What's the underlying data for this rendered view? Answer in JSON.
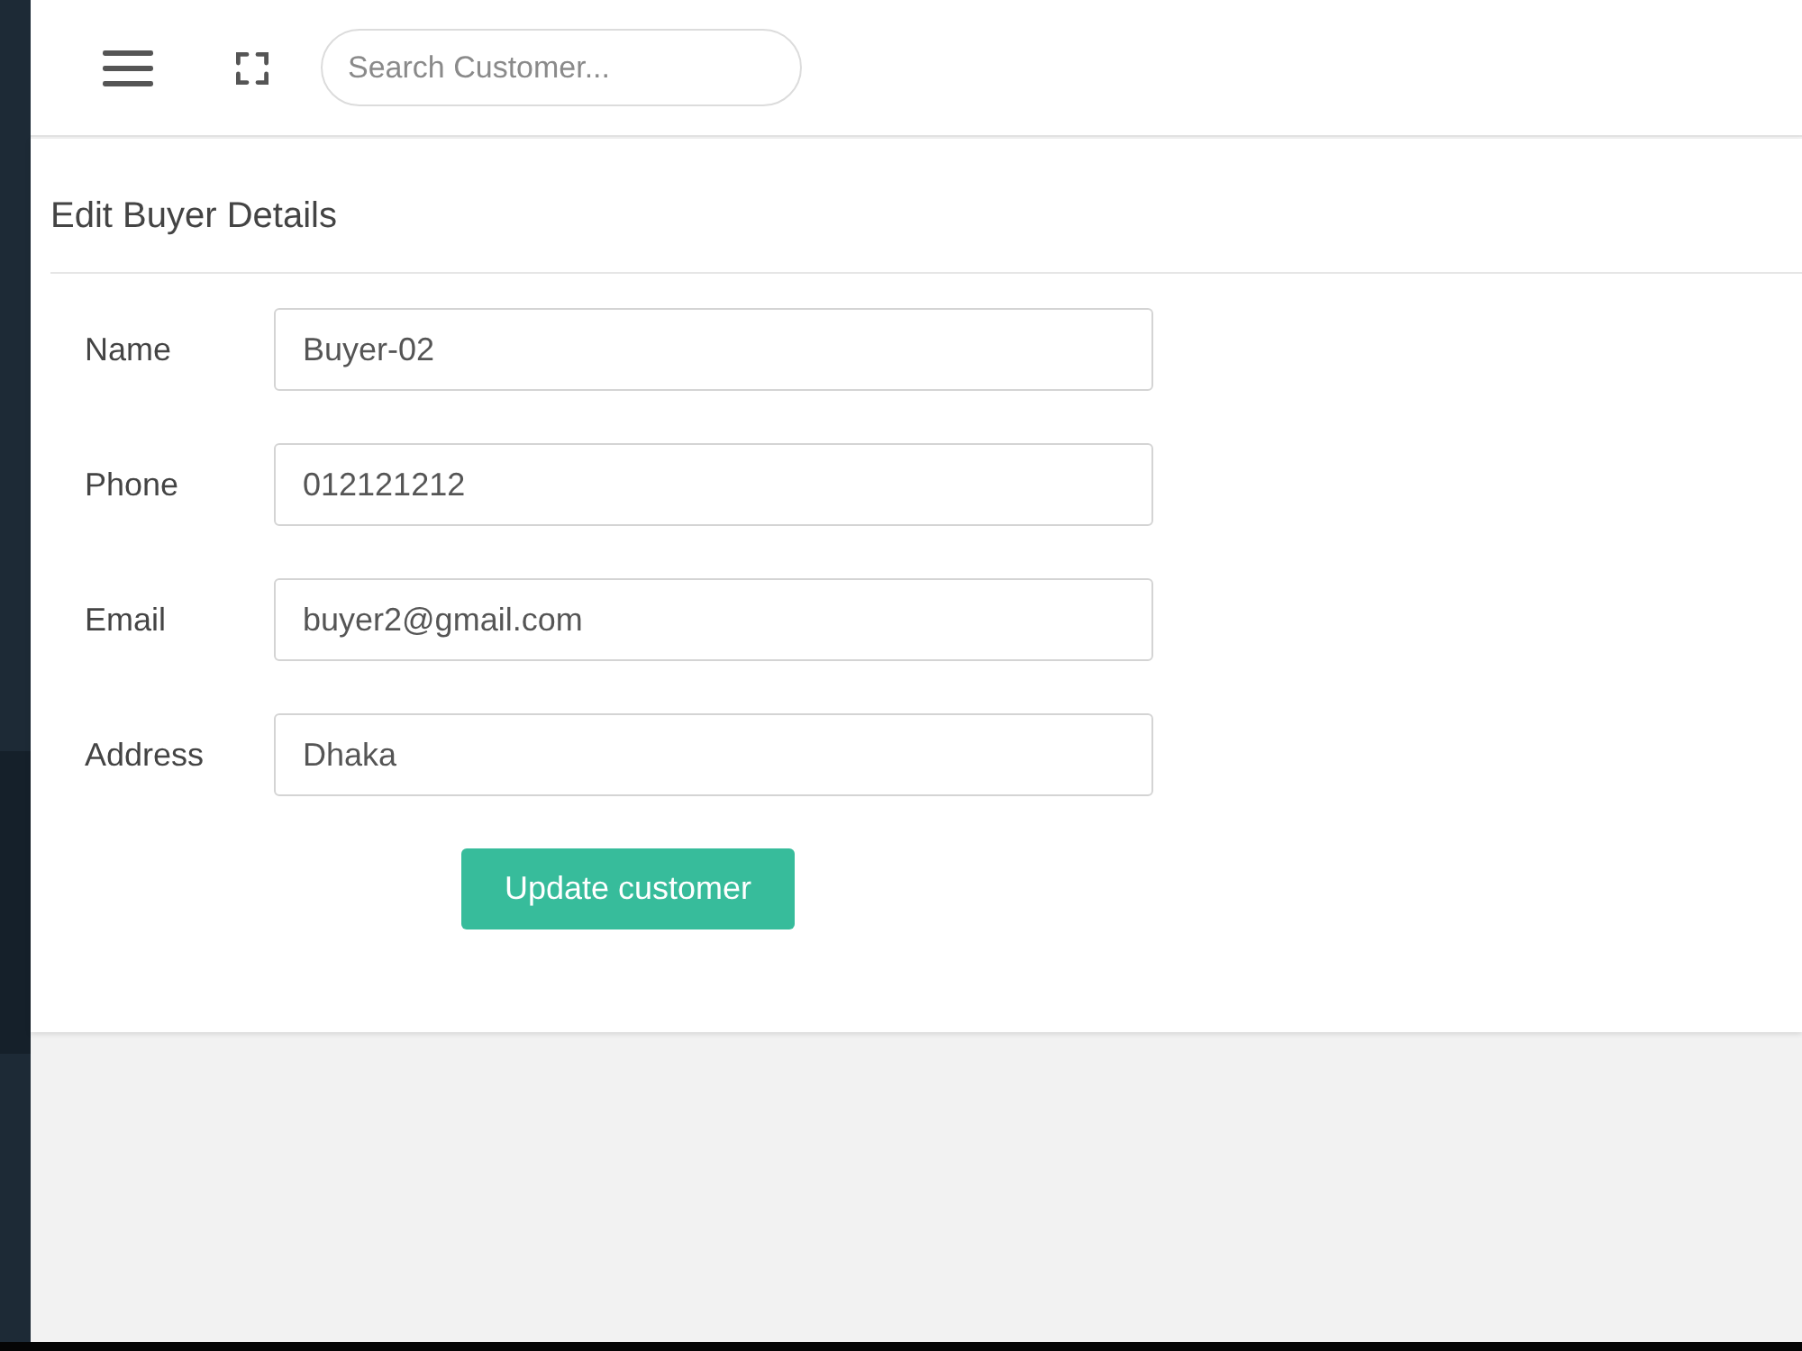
{
  "topbar": {
    "search": {
      "placeholder": "Search Customer..."
    }
  },
  "card": {
    "title": "Edit Buyer Details",
    "fields": [
      {
        "label": "Name",
        "value": "Buyer-02"
      },
      {
        "label": "Phone",
        "value": "012121212"
      },
      {
        "label": "Email",
        "value": "buyer2@gmail.com"
      },
      {
        "label": "Address",
        "value": "Dhaka"
      }
    ],
    "submit_button": "Update customer"
  }
}
